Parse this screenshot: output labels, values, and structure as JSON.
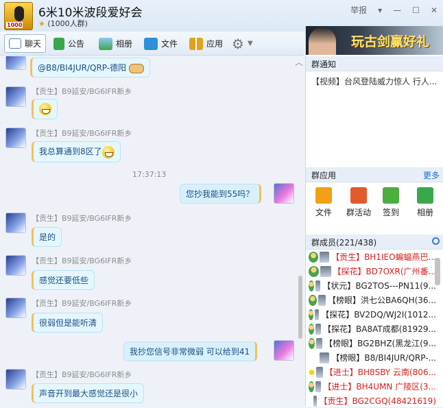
{
  "window": {
    "title": "6米10米波段爱好会",
    "subtitle": "(1000人群)",
    "logo_badge": "1000",
    "report_label": "举报",
    "colors": {
      "accent": "#1d6fd1",
      "bubble": "#e5f7fd",
      "rank": "#d42020"
    }
  },
  "toolbar": {
    "items": [
      {
        "label": "聊天",
        "icon": "chat-icon"
      },
      {
        "label": "公告",
        "icon": "flag-icon"
      },
      {
        "label": "相册",
        "icon": "photo-icon"
      },
      {
        "label": "文件",
        "icon": "folder-icon"
      },
      {
        "label": "应用",
        "icon": "apps-icon"
      }
    ]
  },
  "chat": {
    "close_label": "︿",
    "messages": [
      {
        "text": "@B8/BI4JUR/QRP-德阳"
      },
      {
        "sender": "【贡生】B9延安/BG6IFR新乡",
        "text": ""
      },
      {
        "sender": "【贡生】B9延安/BG6IFR新乡",
        "text": "我总算通到8区了"
      },
      {
        "time": "17:37:13"
      },
      {
        "text": "您抄我能到55吗？"
      },
      {
        "sender": "【贡生】B9延安/BG6IFR新乡",
        "text": "是的"
      },
      {
        "sender": "【贡生】B9延安/BG6IFR新乡",
        "text": "感觉还要低些"
      },
      {
        "sender": "【贡生】B9延安/BG6IFR新乡",
        "text": "很弱但是能听清"
      },
      {
        "text": "我抄您信号非常微弱 可以给到41"
      },
      {
        "sender": "【贡生】B9延安/BG6IFR新乡",
        "text": "声音开到最大感觉还是很小"
      }
    ]
  },
  "right": {
    "ad_text": "玩古剑赢好礼",
    "notice_title": "群通知",
    "notice_text": "【视频】台风登陆威力惊人 行人...",
    "apps_title": "群应用",
    "apps_more": "更多",
    "apps": [
      {
        "label": "文件",
        "color": "#f2a017"
      },
      {
        "label": "群活动",
        "color": "#e25a2a"
      },
      {
        "label": "签到",
        "color": "#4caf3d"
      },
      {
        "label": "相册",
        "color": "#3aa84a"
      }
    ],
    "members_title": "群成员(221/438)",
    "members": [
      {
        "rank": "【贡生】",
        "name": "BH1IEO蝙蝠燕巴...",
        "color": "#d42020"
      },
      {
        "rank": "【探花】",
        "name": "BD7OXR(广州番...",
        "color": "#d42020"
      },
      {
        "rank": "【状元】",
        "name": "BG2TOS---PN11(9...",
        "color": "#222222"
      },
      {
        "rank": "【榜眼】",
        "name": "洪七公BA6QH(36...",
        "color": "#222222"
      },
      {
        "rank": "【探花】",
        "name": "BV2DQ/WJ2I(1012...",
        "color": "#222222"
      },
      {
        "rank": "【探花】",
        "name": "BA8AT成都(81929...",
        "color": "#222222"
      },
      {
        "rank": "【榜眼】",
        "name": "BG2BHZ(黑龙江(9...",
        "color": "#222222"
      },
      {
        "rank": "【榜眼】",
        "name": "B8/BI4JUR/QRP-...",
        "color": "#222222"
      },
      {
        "rank": "【进士】",
        "name": "BH8SBY 云南(806...",
        "color": "#d42020"
      },
      {
        "rank": "【进士】",
        "name": "BH4UMN 广陵区(3...",
        "color": "#d42020"
      },
      {
        "rank": "【贡生】",
        "name": "BG2CGQ(48421619)",
        "color": "#d42020"
      }
    ]
  }
}
